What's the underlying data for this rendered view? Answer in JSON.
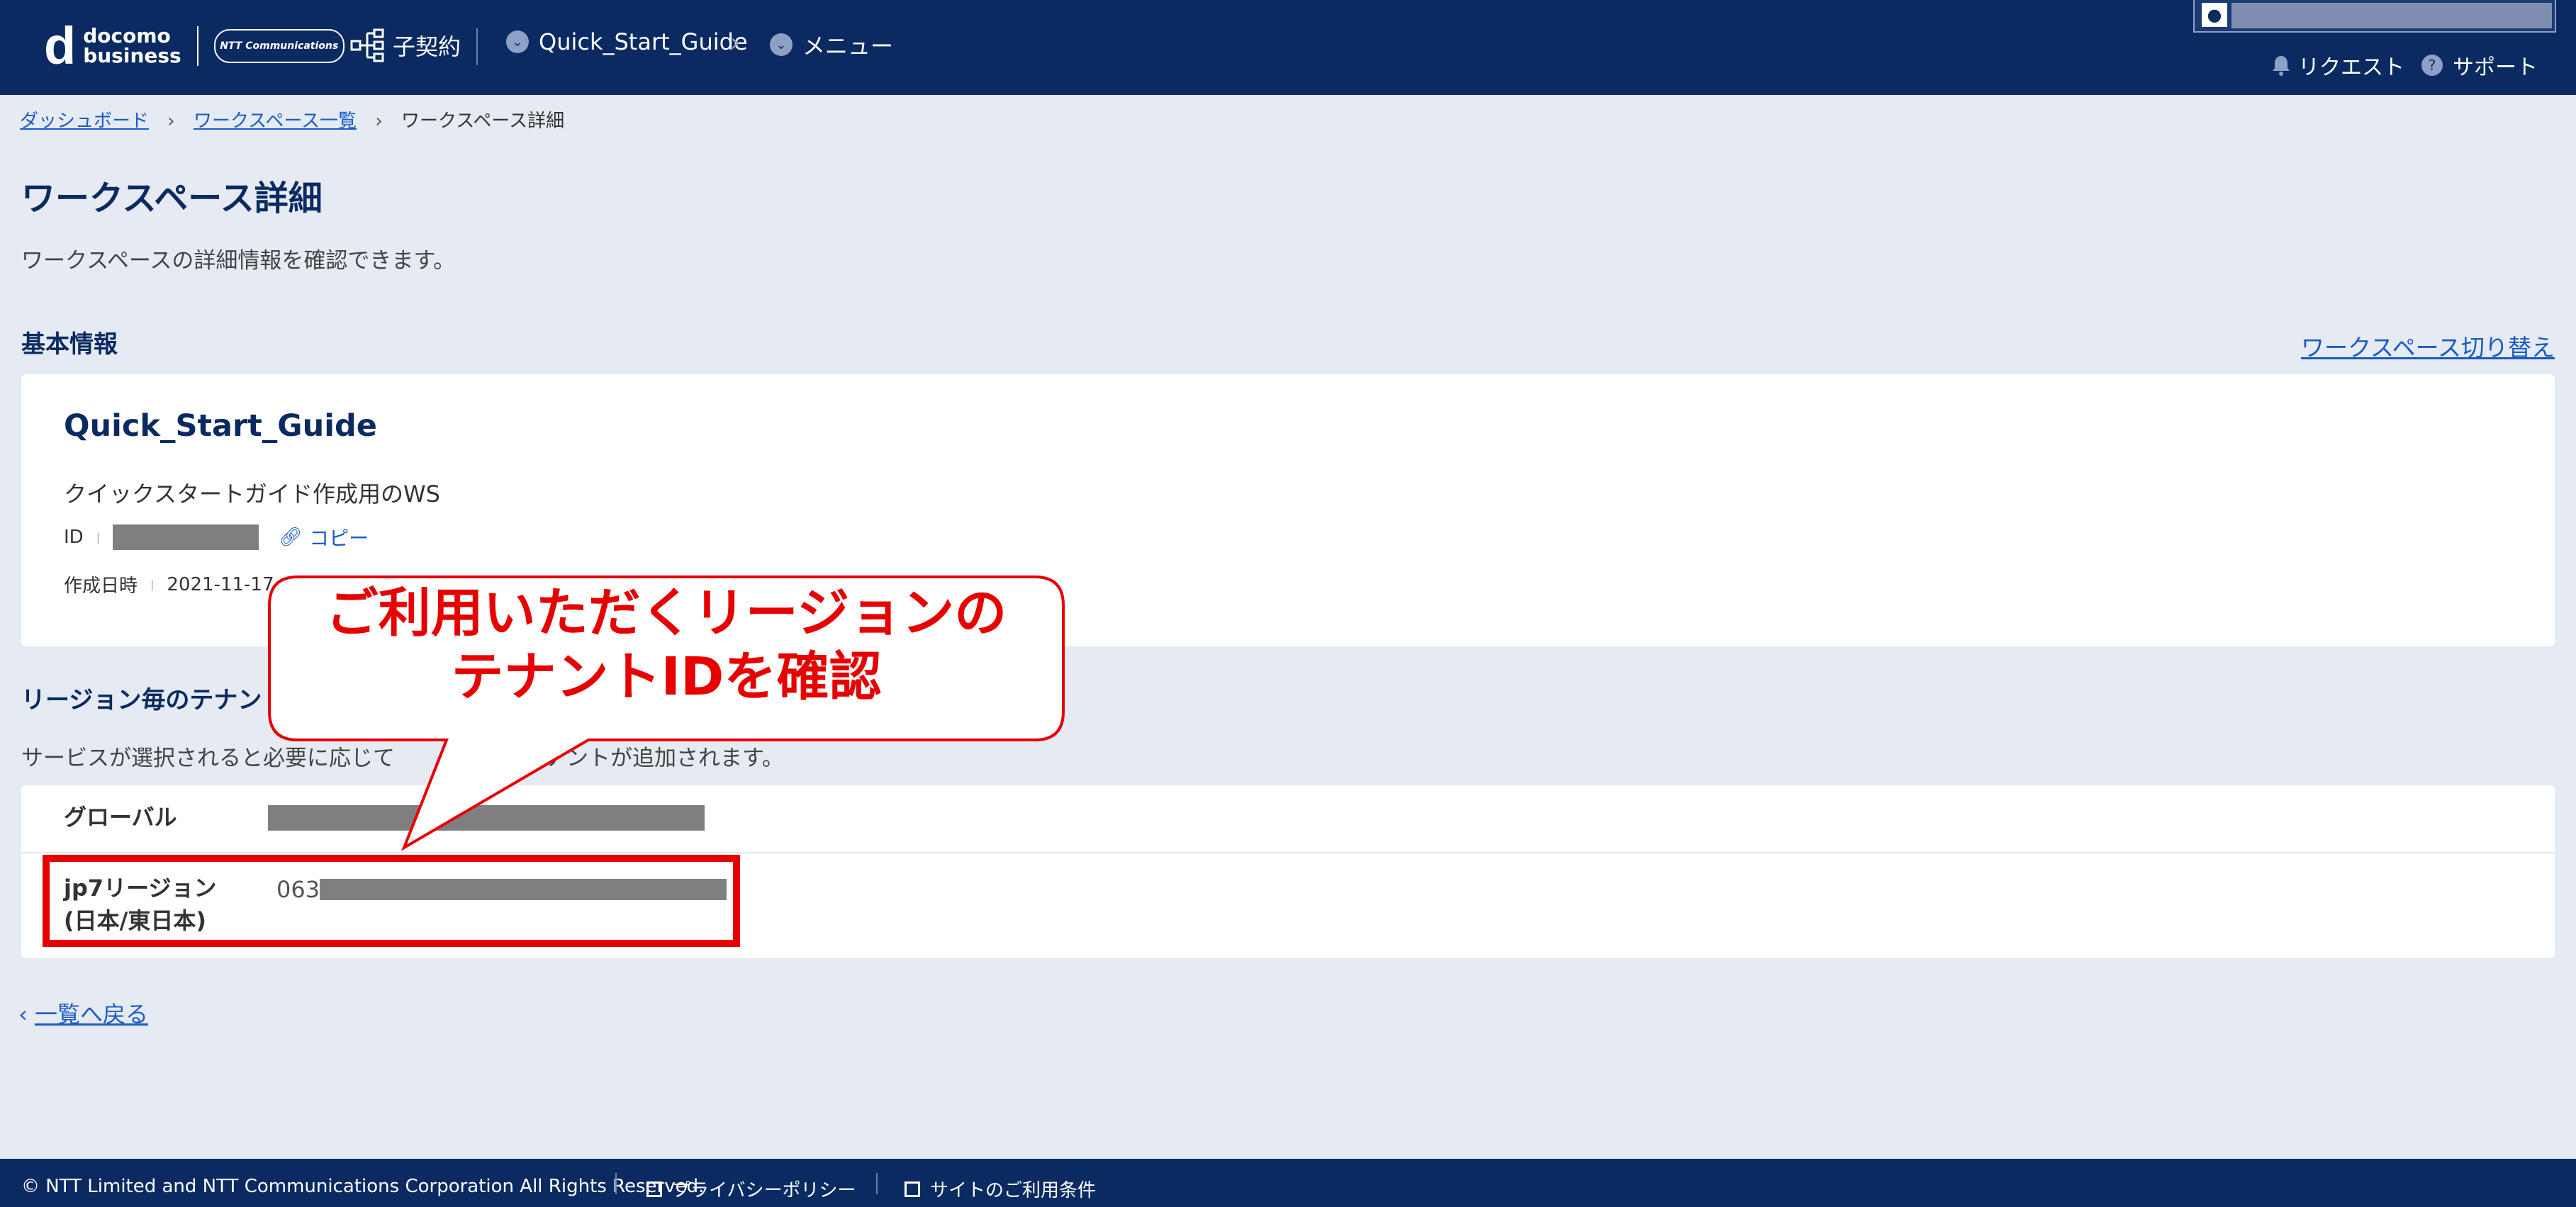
{
  "header": {
    "logo_brand_top": "docomo",
    "logo_brand_bottom": "business",
    "logo_ntt": "NTT Communications",
    "contract_label": "子契約",
    "workspace_label": "Quick_Start_Guide",
    "menu_label": "メニュー",
    "request_label": "リクエスト",
    "support_label": "サポート"
  },
  "breadcrumb": {
    "dashboard": "ダッシュボード",
    "workspace_list": "ワークスペース一覧",
    "current": "ワークスペース詳細"
  },
  "page": {
    "title": "ワークスペース詳細",
    "description": "ワークスペースの詳細情報を確認できます。"
  },
  "basic_info": {
    "section_title": "基本情報",
    "switch_link": "ワークスペース切り替え",
    "ws_name": "Quick_Start_Guide",
    "ws_description": "クイックスタートガイド作成用のWS",
    "id_label": "ID",
    "copy_label": "コピー",
    "created_label": "作成日時",
    "created_value": "2021-11-17"
  },
  "tenant": {
    "section_title": "リージョン毎のテナン",
    "description_start": "サービスが選択されると必要に応じて",
    "description_end": "テナントが追加されます。",
    "rows": [
      {
        "label": "グローバル",
        "value": ""
      },
      {
        "label": "jp7リージョン",
        "label2": "(日本/東日本)",
        "value": "063"
      }
    ]
  },
  "back_link": "一覧へ戻る",
  "callout": {
    "line1": "ご利用いただくリージョンの",
    "line2": "テナントIDを確認"
  },
  "footer": {
    "copyright": "© NTT Limited and NTT Communications Corporation All Rights Reserved.",
    "privacy": "プライバシーポリシー",
    "terms": "サイトのご利用条件"
  },
  "colors": {
    "header_bg": "#0a2a61",
    "page_bg": "#e6eaf3",
    "link": "#1a5bc4",
    "callout_red": "#e60000"
  }
}
